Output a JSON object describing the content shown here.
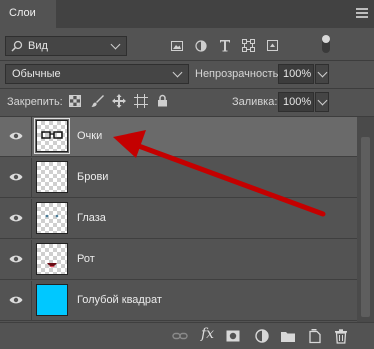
{
  "panel": {
    "tab_title": "Слои"
  },
  "filter": {
    "kind_label": "Вид"
  },
  "blend": {
    "mode": "Обычные",
    "opacity_label": "Непрозрачность:",
    "opacity_value": "100%"
  },
  "lock": {
    "label": "Закрепить:",
    "fill_label": "Заливка:",
    "fill_value": "100%"
  },
  "layers": [
    {
      "name": "Очки",
      "selected": true
    },
    {
      "name": "Брови",
      "selected": false
    },
    {
      "name": "Глаза",
      "selected": false
    },
    {
      "name": "Рот",
      "selected": false
    },
    {
      "name": "Голубой квадрат",
      "selected": false
    }
  ],
  "colors": {
    "cyan": "#00c8ff",
    "arrow": "#c40000"
  },
  "bottom": {
    "fx_label": "fx"
  }
}
